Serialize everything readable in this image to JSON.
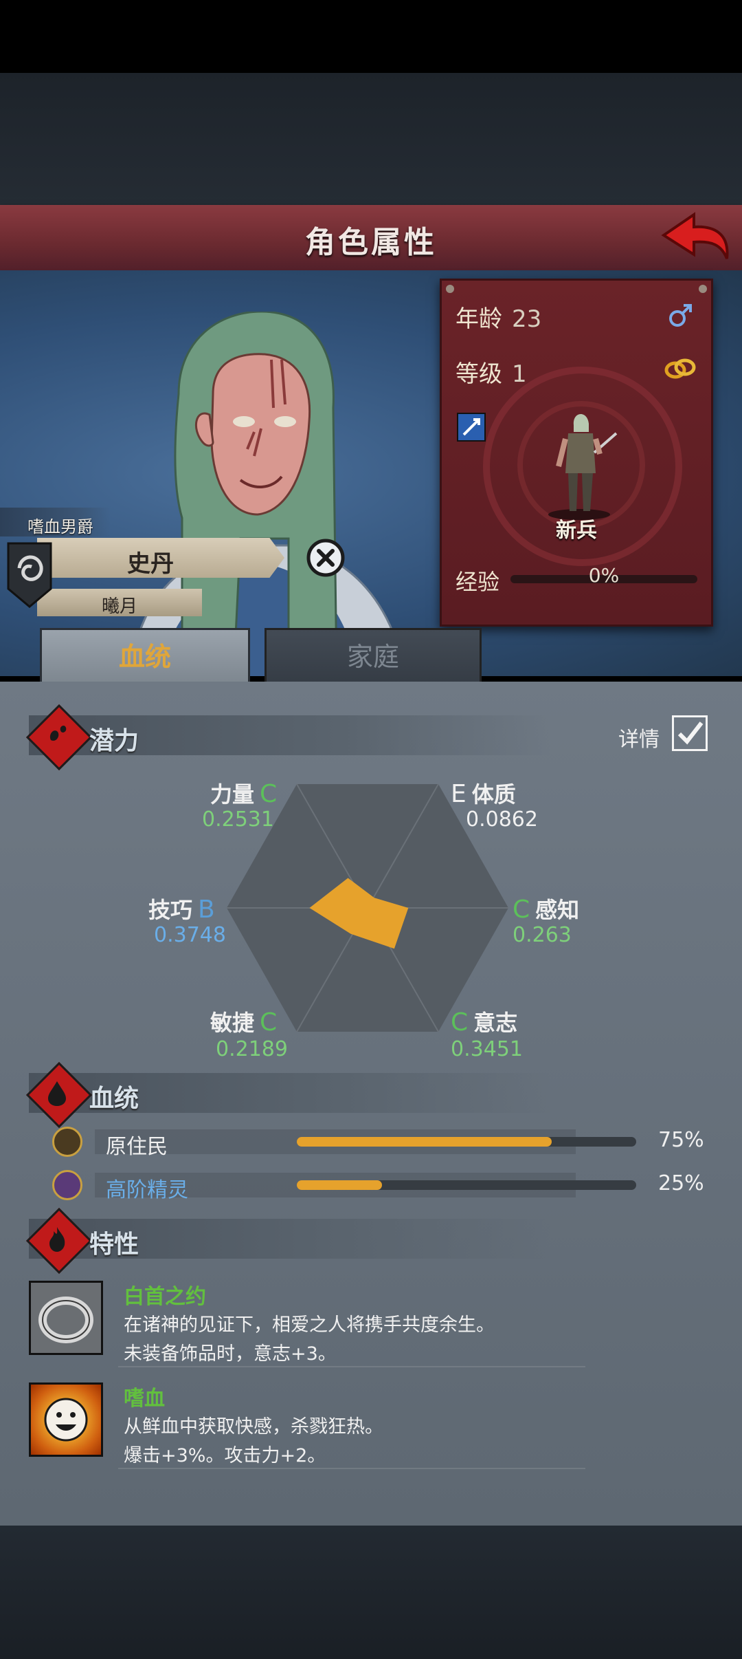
{
  "header": {
    "title": "角色属性"
  },
  "character": {
    "title": "嗜血男爵",
    "name": "史丹",
    "subtitle": "曦月"
  },
  "info": {
    "age_label": "年龄",
    "age": "23",
    "level_label": "等级",
    "level": "1",
    "class_name": "新兵",
    "exp_label": "经验",
    "exp_value": "0%",
    "exp_fraction": 0.0,
    "gender_icon": "male-symbol-icon",
    "marriage_icon": "rings-icon"
  },
  "tabs": {
    "bloodline": "血统",
    "family": "家庭"
  },
  "potential": {
    "section_title": "潜力",
    "detail_label": "详情",
    "detail_checked": true,
    "stats": [
      {
        "name": "力量",
        "grade": "C",
        "value": "0.2531"
      },
      {
        "name": "体质",
        "grade": "E",
        "value": "0.0862"
      },
      {
        "name": "感知",
        "grade": "C",
        "value": "0.263"
      },
      {
        "name": "意志",
        "grade": "C",
        "value": "0.3451"
      },
      {
        "name": "敏捷",
        "grade": "C",
        "value": "0.2189"
      },
      {
        "name": "技巧",
        "grade": "B",
        "value": "0.3748"
      }
    ]
  },
  "bloodline": {
    "section_title": "血统",
    "rows": [
      {
        "name": "原住民",
        "percent": "75%",
        "fraction": 0.75,
        "color": "#f0f0f0"
      },
      {
        "name": "高阶精灵",
        "percent": "25%",
        "fraction": 0.25,
        "color": "#6aaee8"
      }
    ]
  },
  "traits": {
    "section_title": "特性",
    "items": [
      {
        "name": "白首之约",
        "line1": "在诸神的见证下，相爱之人将携手共度余生。",
        "line2": "未装备饰品时，意志+3。"
      },
      {
        "name": "嗜血",
        "line1": "从鲜血中获取快感，杀戮狂热。",
        "line2": "爆击+3%。攻击力+2。"
      }
    ]
  },
  "colors": {
    "accent": "#e6a22c",
    "header": "#7a3038",
    "grade_c": "#5cc05a",
    "grade_b": "#5a9ed8"
  }
}
